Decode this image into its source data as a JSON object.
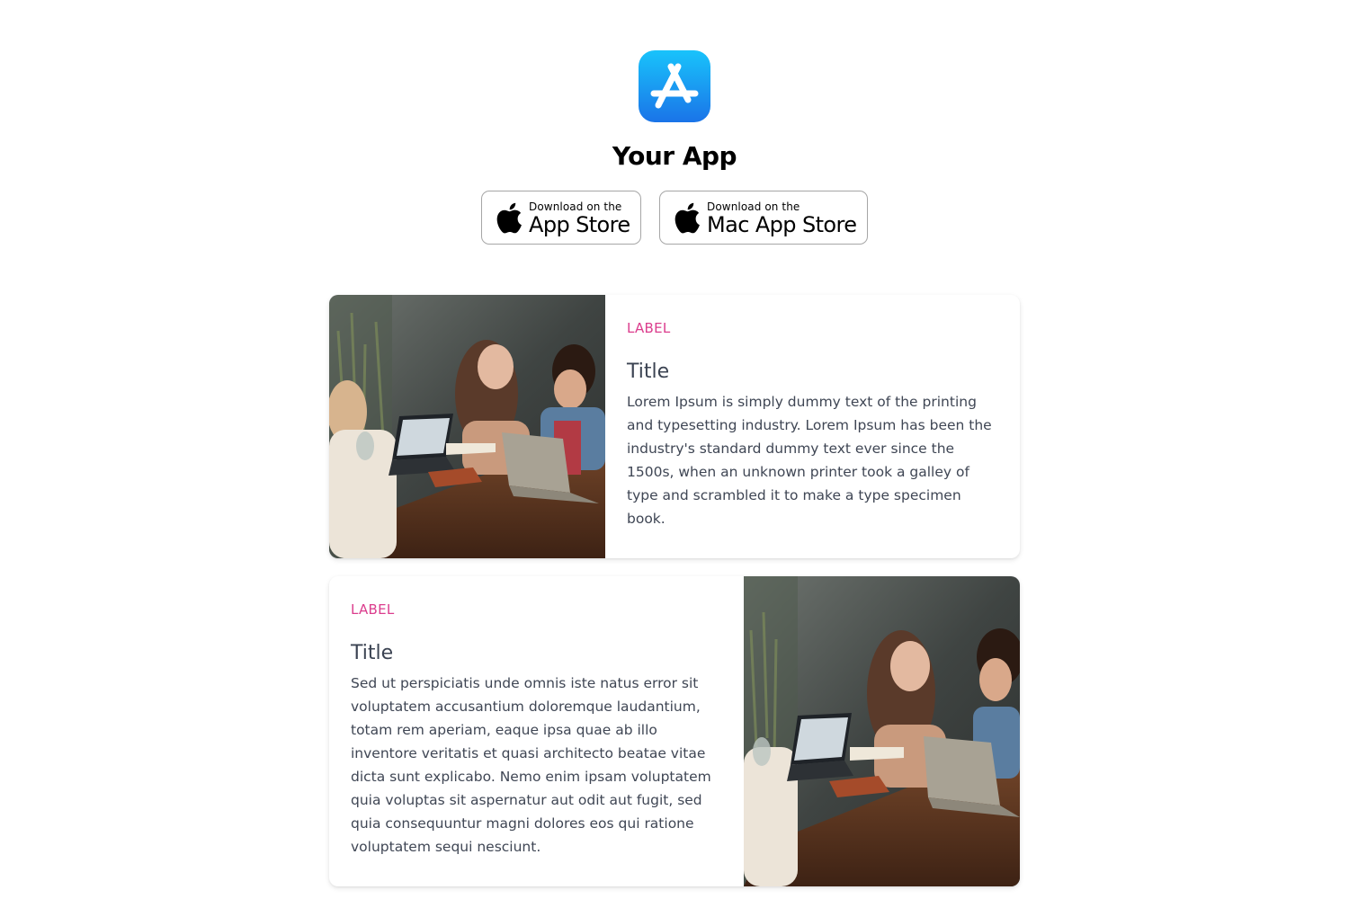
{
  "header": {
    "app_icon": "app-store-icon",
    "app_name": "Your App"
  },
  "badges": [
    {
      "small": "Download on the",
      "big": "App Store",
      "icon": "apple-logo-icon"
    },
    {
      "small": "Download on the",
      "big": "Mac App Store",
      "icon": "apple-logo-icon"
    }
  ],
  "cards": [
    {
      "label": "LABEL",
      "title": "Title",
      "text": "Lorem Ipsum is simply dummy text of the printing and typesetting industry. Lorem Ipsum has been the industry's standard dummy text ever since the 1500s, when an unknown printer took a galley of type and scrambled it to make a type specimen book.",
      "image": "people-working-on-laptops-photo"
    },
    {
      "label": "LABEL",
      "title": "Title",
      "text": "Sed ut perspiciatis unde omnis iste natus error sit voluptatem accusantium doloremque laudantium, totam rem aperiam, eaque ipsa quae ab illo inventore veritatis et quasi architecto beatae vitae dicta sunt explicabo. Nemo enim ipsam voluptatem quia voluptas sit aspernatur aut odit aut fugit, sed quia consequuntur magni dolores eos qui ratione voluptatem sequi nesciunt.",
      "image": "people-working-on-laptops-photo"
    }
  ],
  "colors": {
    "label_accent": "#db3d8d",
    "app_icon_top": "#19c3fb",
    "app_icon_bottom": "#1a74e8",
    "title_text": "#3b4352",
    "body_text": "#3f4654"
  }
}
